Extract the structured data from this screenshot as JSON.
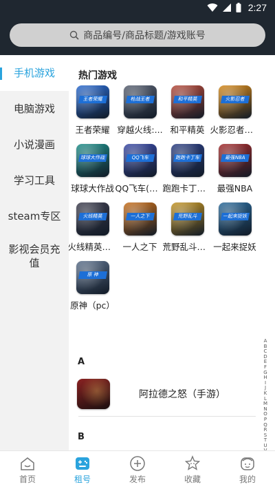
{
  "status": {
    "time": "2:27"
  },
  "search": {
    "placeholder": "商品编号/商品标题/游戏账号"
  },
  "sidebar": {
    "items": [
      {
        "label": "手机游戏"
      },
      {
        "label": "电脑游戏"
      },
      {
        "label": "小说漫画"
      },
      {
        "label": "学习工具"
      },
      {
        "label": "steam专区"
      },
      {
        "label": "影视会员充值"
      }
    ]
  },
  "hot": {
    "title": "热门游戏",
    "games": [
      {
        "name": "王者荣耀",
        "badge": "王者荣耀",
        "color": "#2b6bd1"
      },
      {
        "name": "穿越火线:...",
        "badge": "枪战王者",
        "color": "#586071"
      },
      {
        "name": "和平精英",
        "badge": "和平精英",
        "color": "#b74a3a"
      },
      {
        "name": "火影忍者（...",
        "badge": "火影忍者",
        "color": "#d78a1a"
      },
      {
        "name": "球球大作战",
        "badge": "球球大作战",
        "color": "#1f8f8a"
      },
      {
        "name": "QQ飞车(手...",
        "badge": "QQ飞车",
        "color": "#3a4aa6"
      },
      {
        "name": "跑跑卡丁车...",
        "badge": "跑跑卡丁车",
        "color": "#2c3f83"
      },
      {
        "name": "最强NBA",
        "badge": "最强NBA",
        "color": "#a52c2c"
      },
      {
        "name": "火线精英（...",
        "badge": "火线精英",
        "color": "#3f3f4f"
      },
      {
        "name": "一人之下",
        "badge": "一人之下",
        "color": "#c96f1b"
      },
      {
        "name": "荒野乱斗（...",
        "badge": "荒野乱斗",
        "color": "#c59625"
      },
      {
        "name": "一起来捉妖",
        "badge": "一起来捉妖",
        "color": "#2b6b9b"
      },
      {
        "name": "原神（pc）",
        "badge": "原 神",
        "color": "#5b6f8a"
      }
    ]
  },
  "groups": [
    {
      "letter": "A",
      "items": [
        {
          "name": "阿拉德之怒（手游）",
          "color": "#8a2222"
        }
      ]
    },
    {
      "letter": "B"
    }
  ],
  "alphabet": [
    "A",
    "B",
    "C",
    "D",
    "E",
    "F",
    "G",
    "H",
    "I",
    "J",
    "K",
    "L",
    "M",
    "N",
    "O",
    "P",
    "Q",
    "R",
    "S",
    "T",
    "U",
    "V",
    "W",
    "X",
    "Y",
    "Z"
  ],
  "tabbar": {
    "tabs": [
      {
        "label": "首页",
        "icon": "home-icon"
      },
      {
        "label": "租号",
        "icon": "gamepad-icon"
      },
      {
        "label": "发布",
        "icon": "plus-circle-icon"
      },
      {
        "label": "收藏",
        "icon": "star-face-icon"
      },
      {
        "label": "我的",
        "icon": "user-face-icon"
      }
    ],
    "active_color": "#2aa3dd"
  }
}
